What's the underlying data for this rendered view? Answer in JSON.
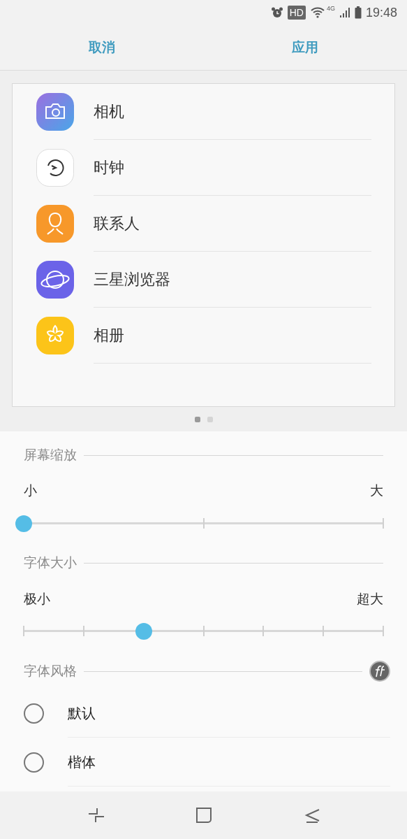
{
  "status_bar": {
    "network": "4G",
    "hd": "HD",
    "time": "19:48"
  },
  "header": {
    "cancel": "取消",
    "apply": "应用"
  },
  "preview": {
    "apps": [
      {
        "kind": "camera",
        "label": "相机"
      },
      {
        "kind": "clock",
        "label": "时钟"
      },
      {
        "kind": "contacts",
        "label": "联系人"
      },
      {
        "kind": "browser",
        "label": "三星浏览器"
      },
      {
        "kind": "gallery",
        "label": "相册"
      }
    ],
    "pages": [
      {
        "selected": true
      },
      {
        "selected": false
      }
    ]
  },
  "screen_zoom": {
    "title": "屏幕缩放",
    "min_label": "小",
    "max_label": "大",
    "level": 0
  },
  "font_size": {
    "title": "字体大小",
    "min_label": "极小",
    "max_label": "超大",
    "level": 0.3333
  },
  "font_style": {
    "title": "字体风格",
    "options": [
      {
        "label": "默认",
        "selected": false
      },
      {
        "label": "楷体",
        "selected": false
      }
    ]
  }
}
